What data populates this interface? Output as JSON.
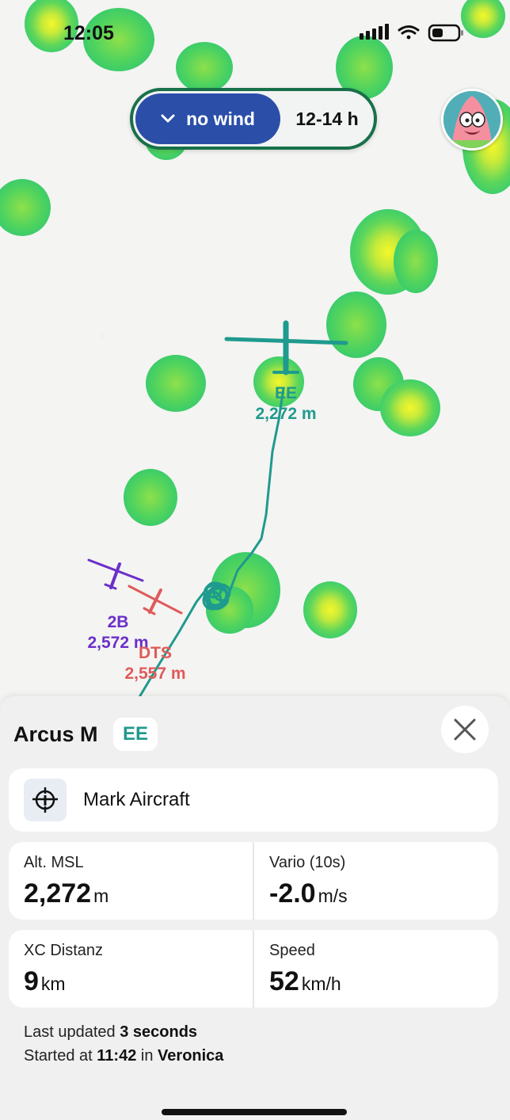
{
  "status_bar": {
    "time": "12:05"
  },
  "wind_control": {
    "selected_label": "no wind",
    "time_range": "12-14 h"
  },
  "map": {
    "aircraft": [
      {
        "id": "EE",
        "callsign": "EE",
        "altitude": "2,272 m",
        "color": "#1f9a8e"
      },
      {
        "id": "2B",
        "callsign": "2B",
        "altitude": "2,572 m",
        "color": "#6b2fc9"
      },
      {
        "id": "DTS",
        "callsign": "DTS",
        "altitude": "2,557 m",
        "color": "#e05a5a"
      }
    ]
  },
  "panel": {
    "aircraft_type": "Arcus M",
    "registration": "EE",
    "mark_label": "Mark Aircraft",
    "stats": [
      {
        "label": "Alt. MSL",
        "value": "2,272",
        "unit": "m"
      },
      {
        "label": "Vario (10s)",
        "value": "-2.0",
        "unit": "m/s"
      },
      {
        "label": "XC Distanz",
        "value": "9",
        "unit": "km"
      },
      {
        "label": "Speed",
        "value": "52",
        "unit": "km/h"
      }
    ],
    "footer": {
      "last_updated_prefix": "Last updated",
      "last_updated_value": "3 seconds",
      "started_prefix": "Started at",
      "started_time": "11:42",
      "started_mid": "in",
      "started_place": "Veronica"
    }
  },
  "colors": {
    "accent_teal": "#1f9a8e",
    "wind_button": "#2b4fa8",
    "pill_border": "#18704a"
  }
}
